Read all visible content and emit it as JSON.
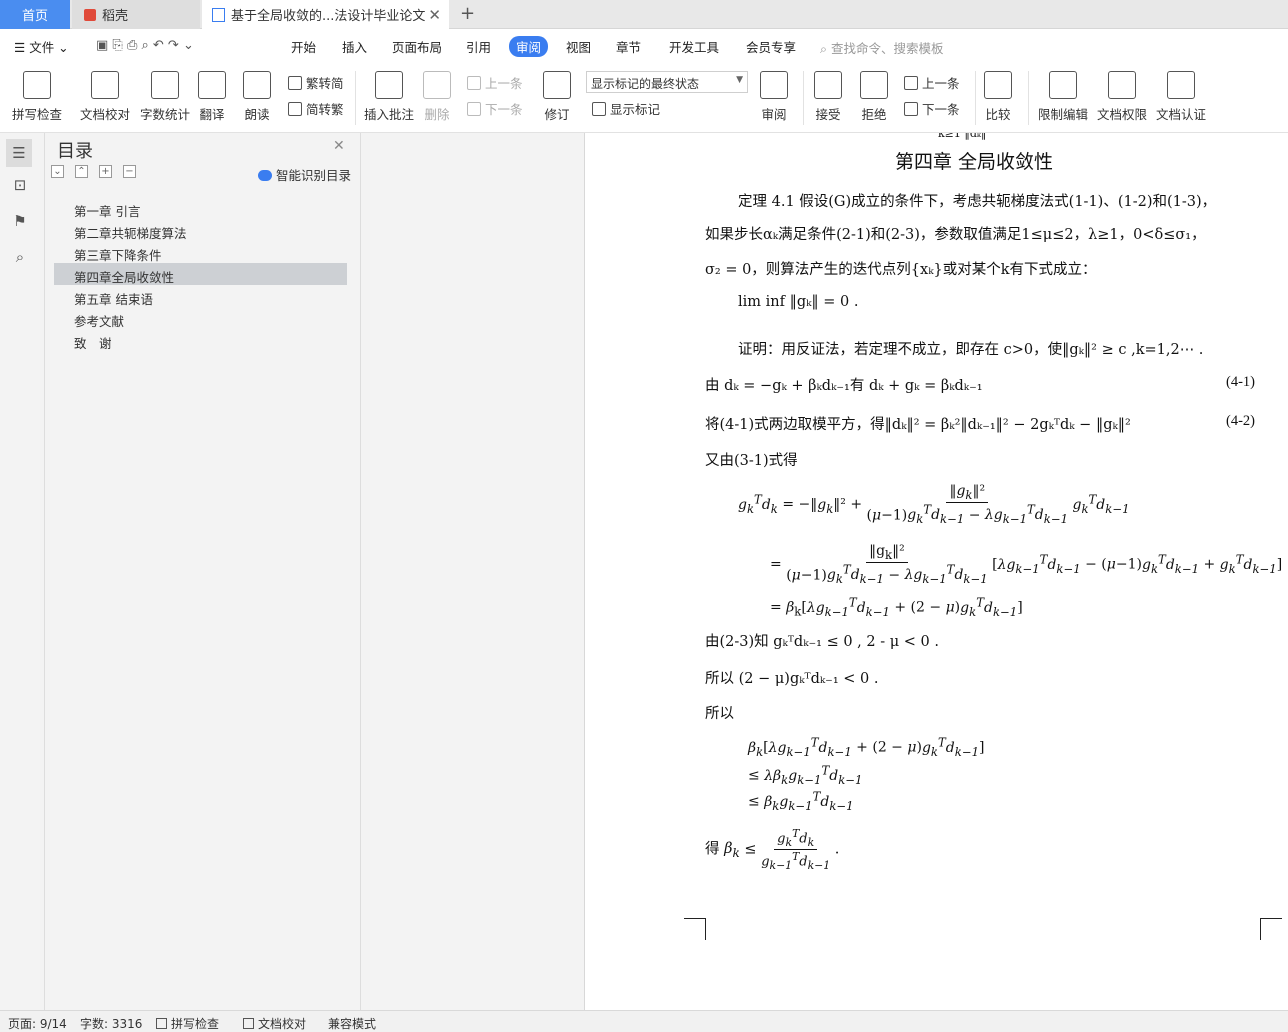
{
  "tabs": {
    "home": "首页",
    "daoke": "稻壳",
    "doc": "基于全局收敛的...法设计毕业论文"
  },
  "menu": {
    "file": "文件",
    "items": [
      "开始",
      "插入",
      "页面布局",
      "引用",
      "审阅",
      "视图",
      "章节",
      "开发工具",
      "会员专享"
    ],
    "search": "查找命令、搜索模板"
  },
  "ribbon": {
    "spell": "拼写检查",
    "proof": "文档校对",
    "wordcount": "字数统计",
    "translate": "翻译",
    "read": "朗读",
    "trad": "繁转简",
    "simp": "简转繁",
    "comment": "插入批注",
    "delete": "删除",
    "prev": "上一条",
    "next": "下一条",
    "revise": "修订",
    "state": "显示标记的最终状态",
    "showmark": "显示标记",
    "review": "审阅",
    "accept": "接受",
    "reject": "拒绝",
    "prev2": "上一条",
    "next2": "下一条",
    "compare": "比较",
    "restrict": "限制编辑",
    "rights": "文档权限",
    "auth": "文档认证"
  },
  "toc": {
    "title": "目录",
    "smart": "智能识别目录",
    "items": [
      "第一章 引言",
      "第二章共轭梯度算法",
      "第三章下降条件",
      "第四章全局收敛性",
      "第五章 结束语",
      "参考文献",
      "致　谢"
    ],
    "selected": 3
  },
  "doc": {
    "chapter": "第四章 全局收敛性",
    "p1": "定理 4.1 假设(G)成立的条件下，考虑共轭梯度法式(1-1)、(1-2)和(1-3)，",
    "p2": "如果步长αₖ满足条件(2-1)和(2-3)，参数取值满足1≤μ≤2，λ≥1，0<δ≤σ₁，",
    "p3": "σ₂ = 0，则算法产生的迭代点列{xₖ}或对某个k有下式成立：",
    "p4": "lim inf ‖gₖ‖ = 0 .",
    "p5": "证明：用反证法，若定理不成立，即存在 c>0，使‖gₖ‖² ≥ c ,k=1,2⋯ .",
    "p6": "由 dₖ = −gₖ + βₖdₖ₋₁有 dₖ + gₖ = βₖdₖ₋₁",
    "eq1": "(4-1)",
    "p7": "将(4-1)式两边取模平方，得‖dₖ‖² = βₖ²‖dₖ₋₁‖² − 2gₖᵀdₖ − ‖gₖ‖²",
    "eq2": "(4-2)",
    "p8": "又由(3-1)式得",
    "p9": "由(2-3)知 gₖᵀdₖ₋₁ ≤ 0 , 2 - μ < 0 .",
    "p10": "所以 (2 − μ)gₖᵀdₖ₋₁ < 0 .",
    "p11": "所以",
    "p12": "得"
  },
  "status": {
    "page": "页面: 9/14",
    "words": "字数: 3316",
    "spell": "拼写检查",
    "proof": "文档校对",
    "compat": "兼容模式"
  }
}
